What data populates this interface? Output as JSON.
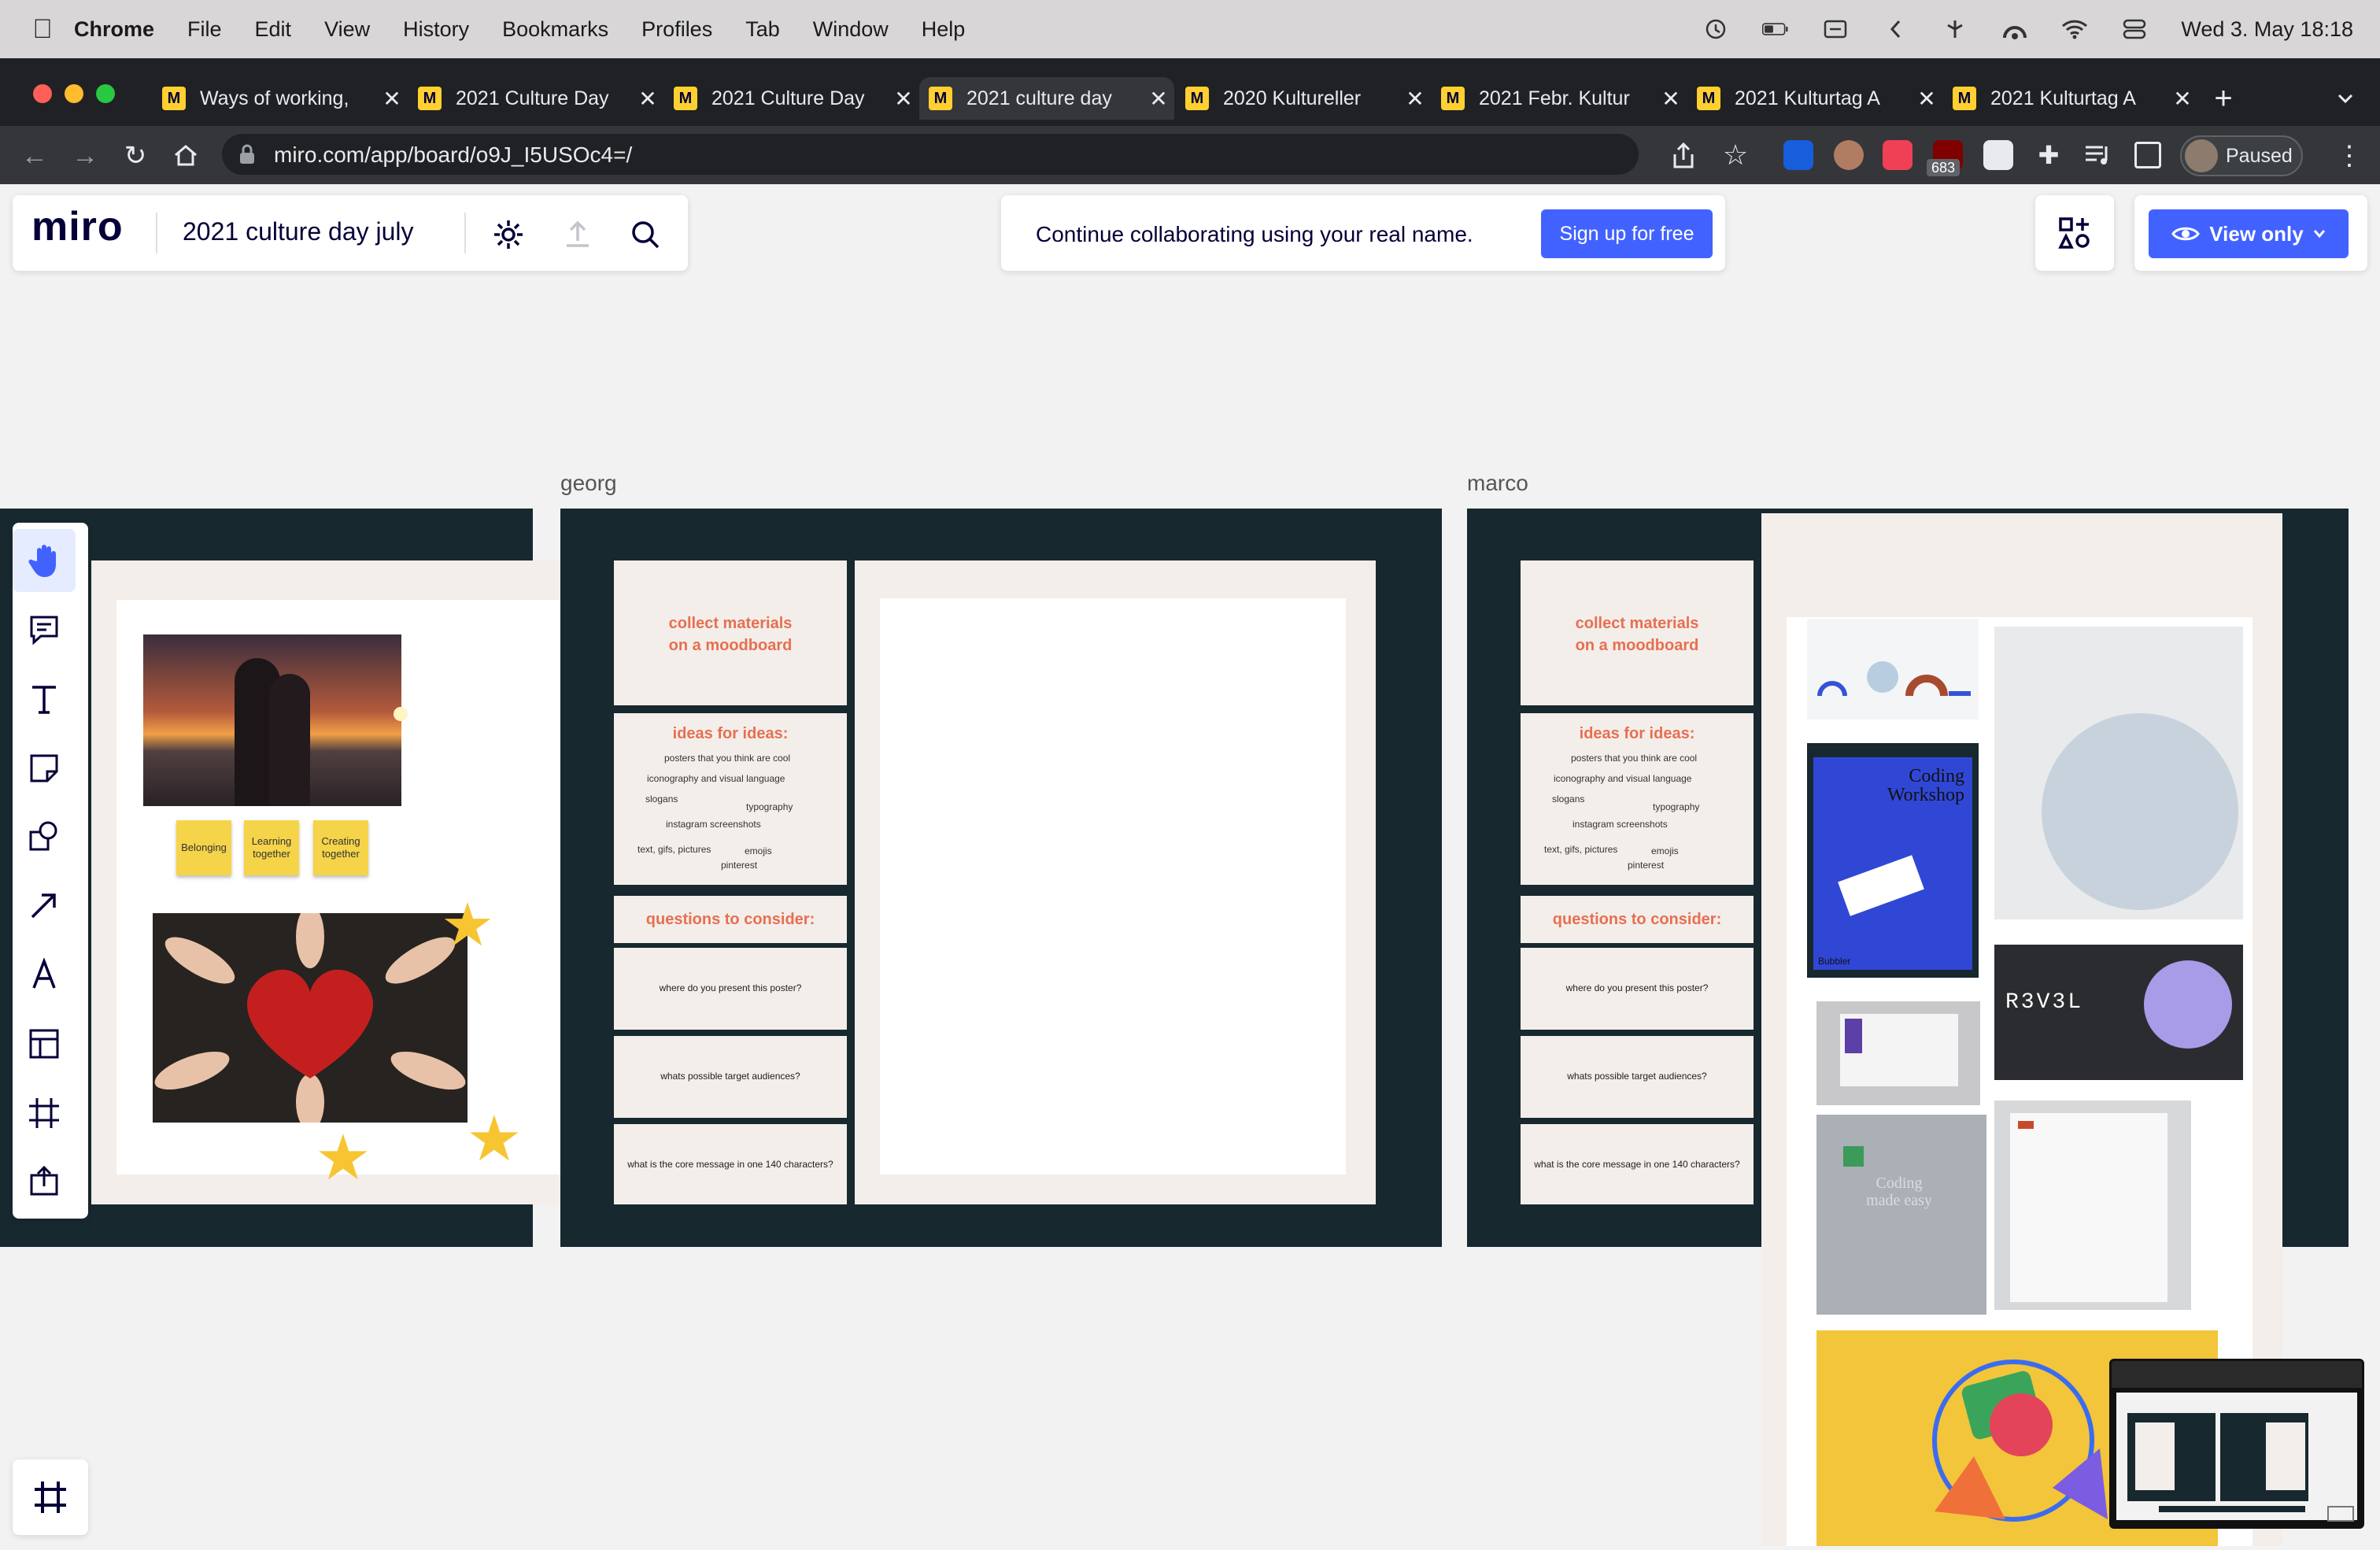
{
  "menubar": {
    "items": [
      "Chrome",
      "File",
      "Edit",
      "View",
      "History",
      "Bookmarks",
      "Profiles",
      "Tab",
      "Window",
      "Help"
    ],
    "datetime": "Wed 3. May  18:18"
  },
  "browser": {
    "tabs": [
      {
        "title": "Ways of working,"
      },
      {
        "title": "2021 Culture Day"
      },
      {
        "title": "2021 Culture Day"
      },
      {
        "title": "2021 culture day"
      },
      {
        "title": "2020 Kultureller"
      },
      {
        "title": "2021 Febr. Kultur"
      },
      {
        "title": "2021 Kulturtag A"
      },
      {
        "title": "2021 Kulturtag A"
      }
    ],
    "url": "miro.com/app/board/o9J_I5USOc4=/",
    "extension_badge": "683",
    "profile_label": "Paused"
  },
  "miro": {
    "logo": "miro",
    "board_title": "2021 culture day july",
    "banner_text": "Continue collaborating using your real name.",
    "signup_label": "Sign up for free",
    "view_only_label": "View only",
    "accent": "#4262ff"
  },
  "frames": {
    "georg_label": "georg",
    "marco_label": "marco"
  },
  "cards": {
    "collect": "collect materials\non a moodboard",
    "ideas_title": "ideas for ideas:",
    "ideas_lines": [
      "posters that you think are cool",
      "iconography and visual language",
      "slogans",
      "typography",
      "instagram screenshots",
      "text, gifs, pictures",
      "emojis",
      "pinterest"
    ],
    "questions": "questions to consider:",
    "q1": "where do you present this poster?",
    "q2": "whats possible target audiences?",
    "q3": "what is the core message in one 140 characters?"
  },
  "stickies": [
    "Belonging",
    "Learning together",
    "Creating together"
  ],
  "moodboard": {
    "poster_title": "Coding\nWorkshop",
    "poster_brand": "Bubbler",
    "revel": "R3V3L",
    "book": "Coding\nmade easy"
  }
}
